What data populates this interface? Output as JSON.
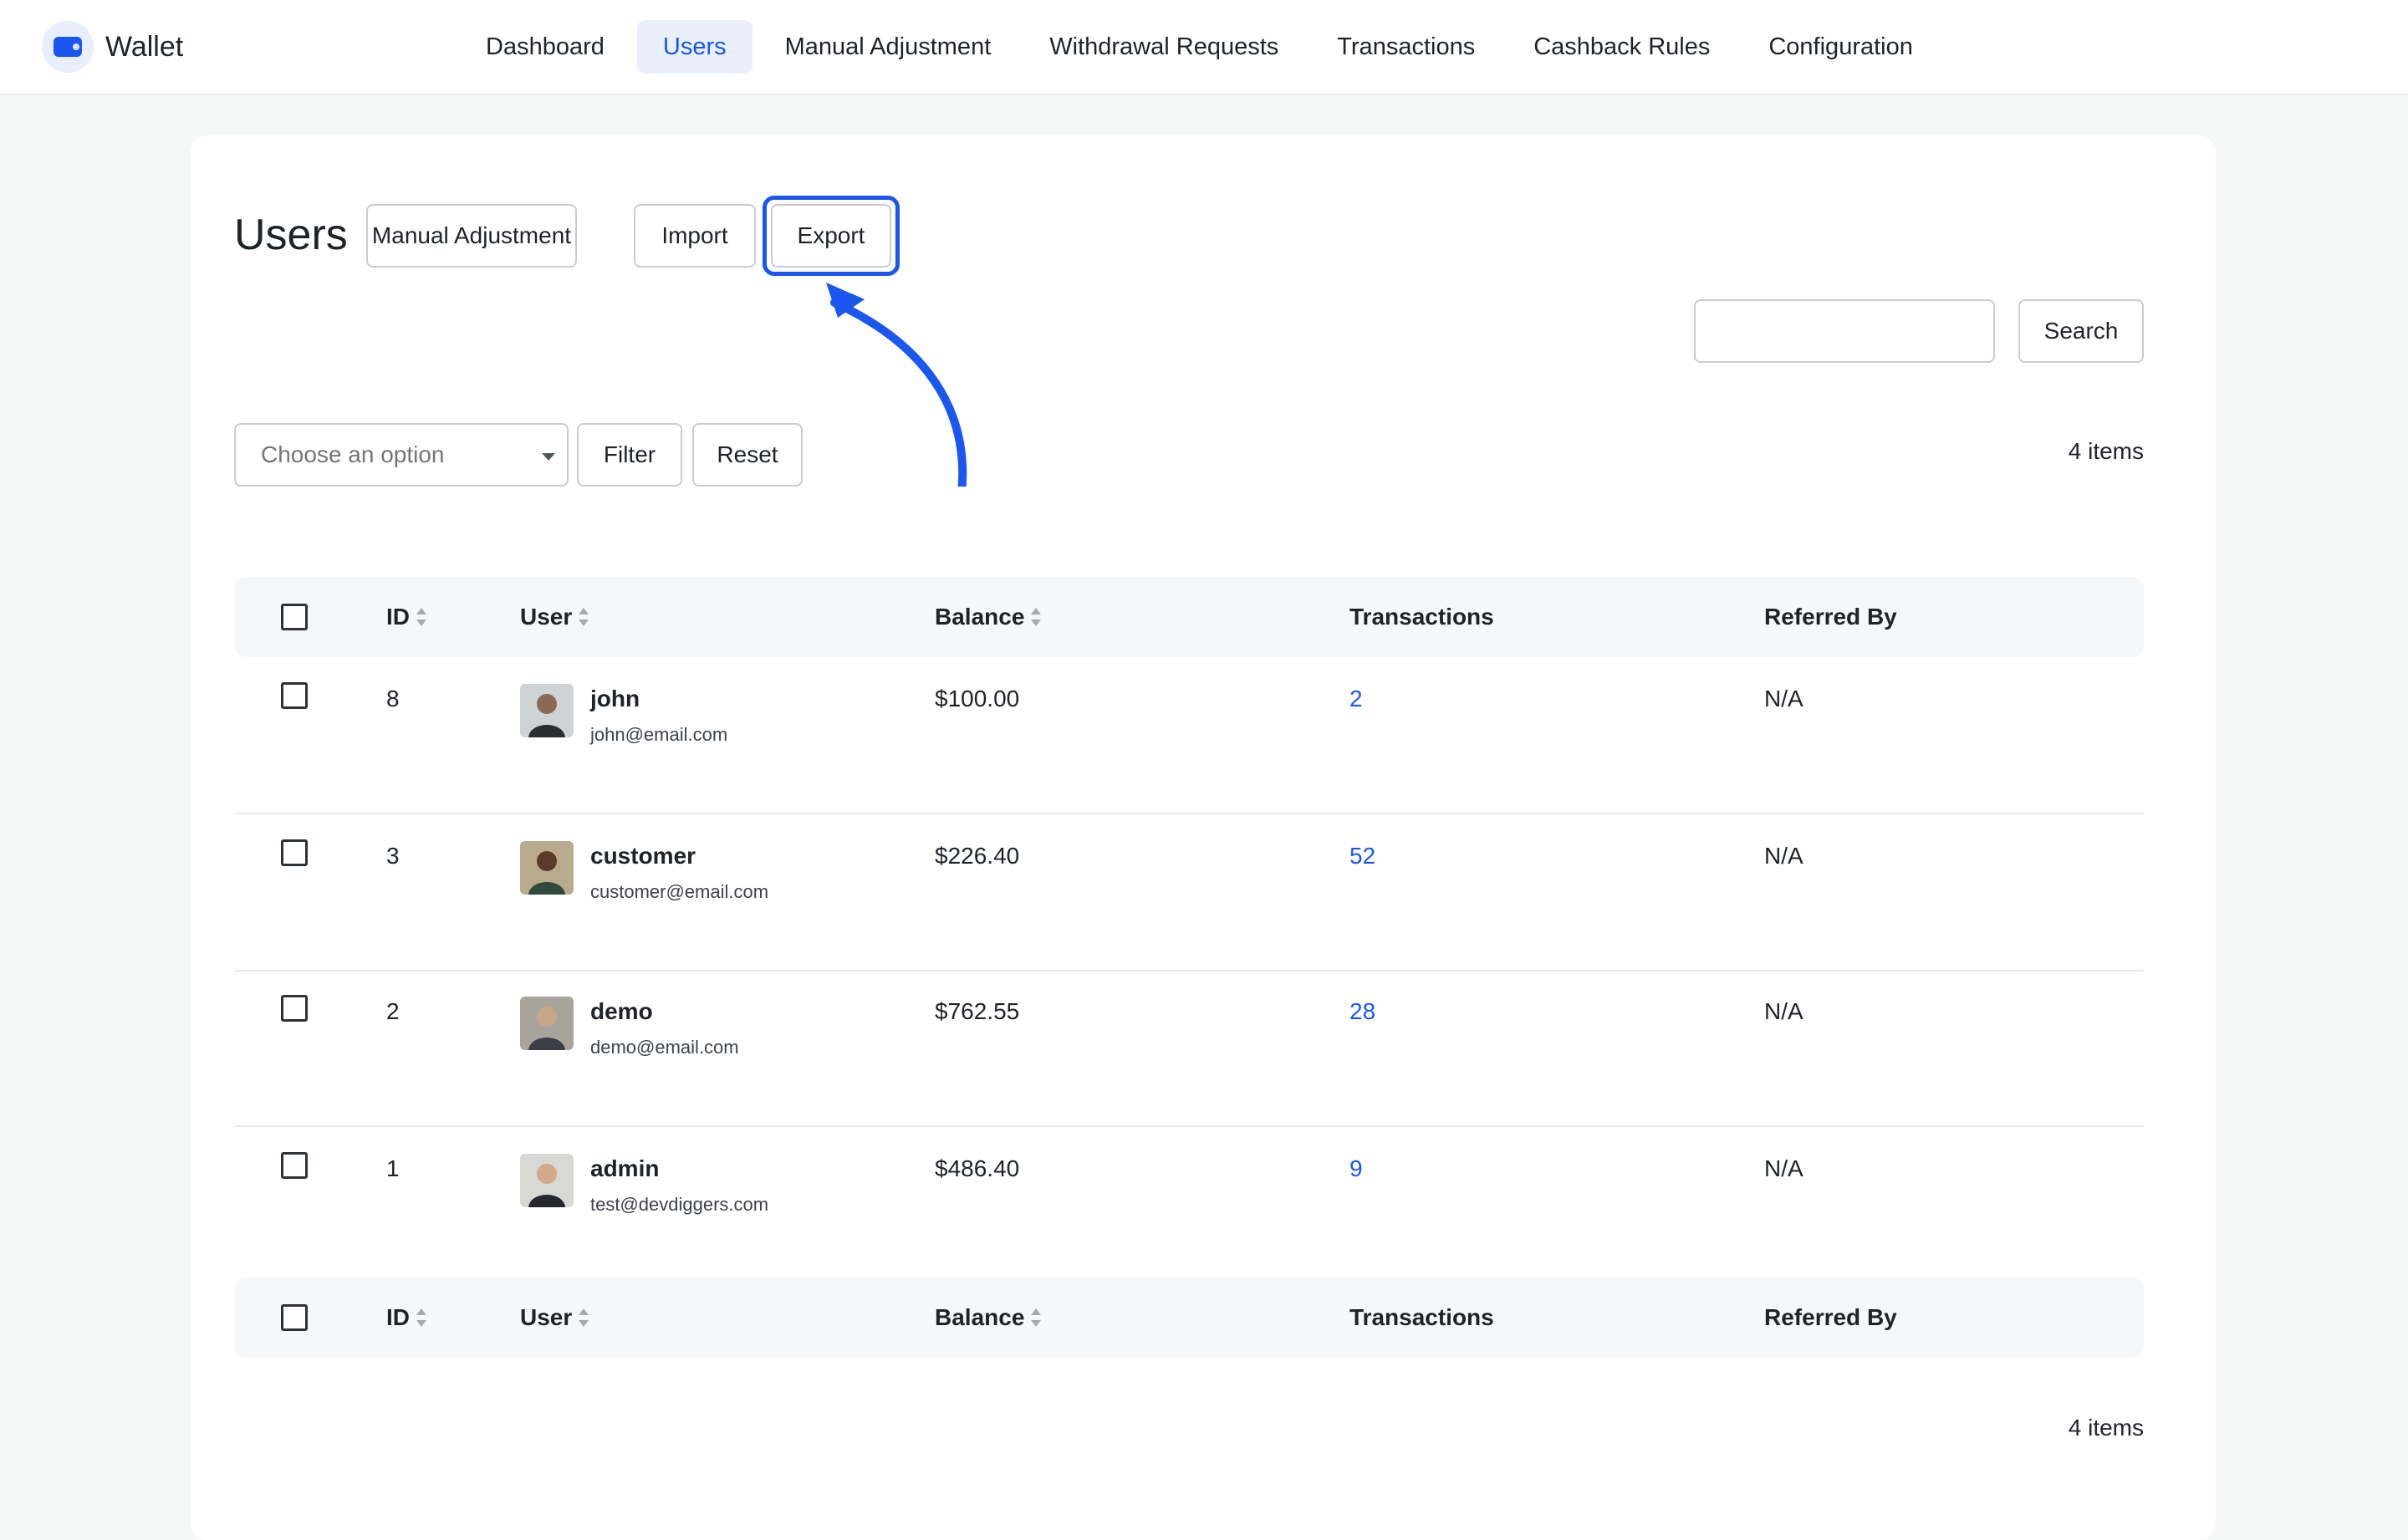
{
  "app": {
    "name": "Wallet"
  },
  "nav": {
    "items": [
      {
        "label": "Dashboard",
        "active": false
      },
      {
        "label": "Users",
        "active": true
      },
      {
        "label": "Manual Adjustment",
        "active": false
      },
      {
        "label": "Withdrawal Requests",
        "active": false
      },
      {
        "label": "Transactions",
        "active": false
      },
      {
        "label": "Cashback Rules",
        "active": false
      },
      {
        "label": "Configuration",
        "active": false
      }
    ]
  },
  "page": {
    "title": "Users",
    "actions": {
      "manual_adjustment": "Manual Adjustment",
      "import": "Import",
      "export": "Export"
    },
    "search": {
      "value": "",
      "button": "Search"
    },
    "filter": {
      "placeholder": "Choose an option",
      "filter_button": "Filter",
      "reset_button": "Reset"
    },
    "items_count": "4 items"
  },
  "table": {
    "columns": {
      "id": "ID",
      "user": "User",
      "balance": "Balance",
      "transactions": "Transactions",
      "referred_by": "Referred By"
    },
    "rows": [
      {
        "id": "8",
        "name": "john",
        "email": "john@email.com",
        "balance": "$100.00",
        "transactions": "2",
        "referred_by": "N/A"
      },
      {
        "id": "3",
        "name": "customer",
        "email": "customer@email.com",
        "balance": "$226.40",
        "transactions": "52",
        "referred_by": "N/A"
      },
      {
        "id": "2",
        "name": "demo",
        "email": "demo@email.com",
        "balance": "$762.55",
        "transactions": "28",
        "referred_by": "N/A"
      },
      {
        "id": "1",
        "name": "admin",
        "email": "test@devdiggers.com",
        "balance": "$486.40",
        "transactions": "9",
        "referred_by": "N/A"
      }
    ]
  },
  "colors": {
    "accent": "#1a56f0",
    "background": "#f6f7f7",
    "header_bg": "#f6f7f9"
  }
}
